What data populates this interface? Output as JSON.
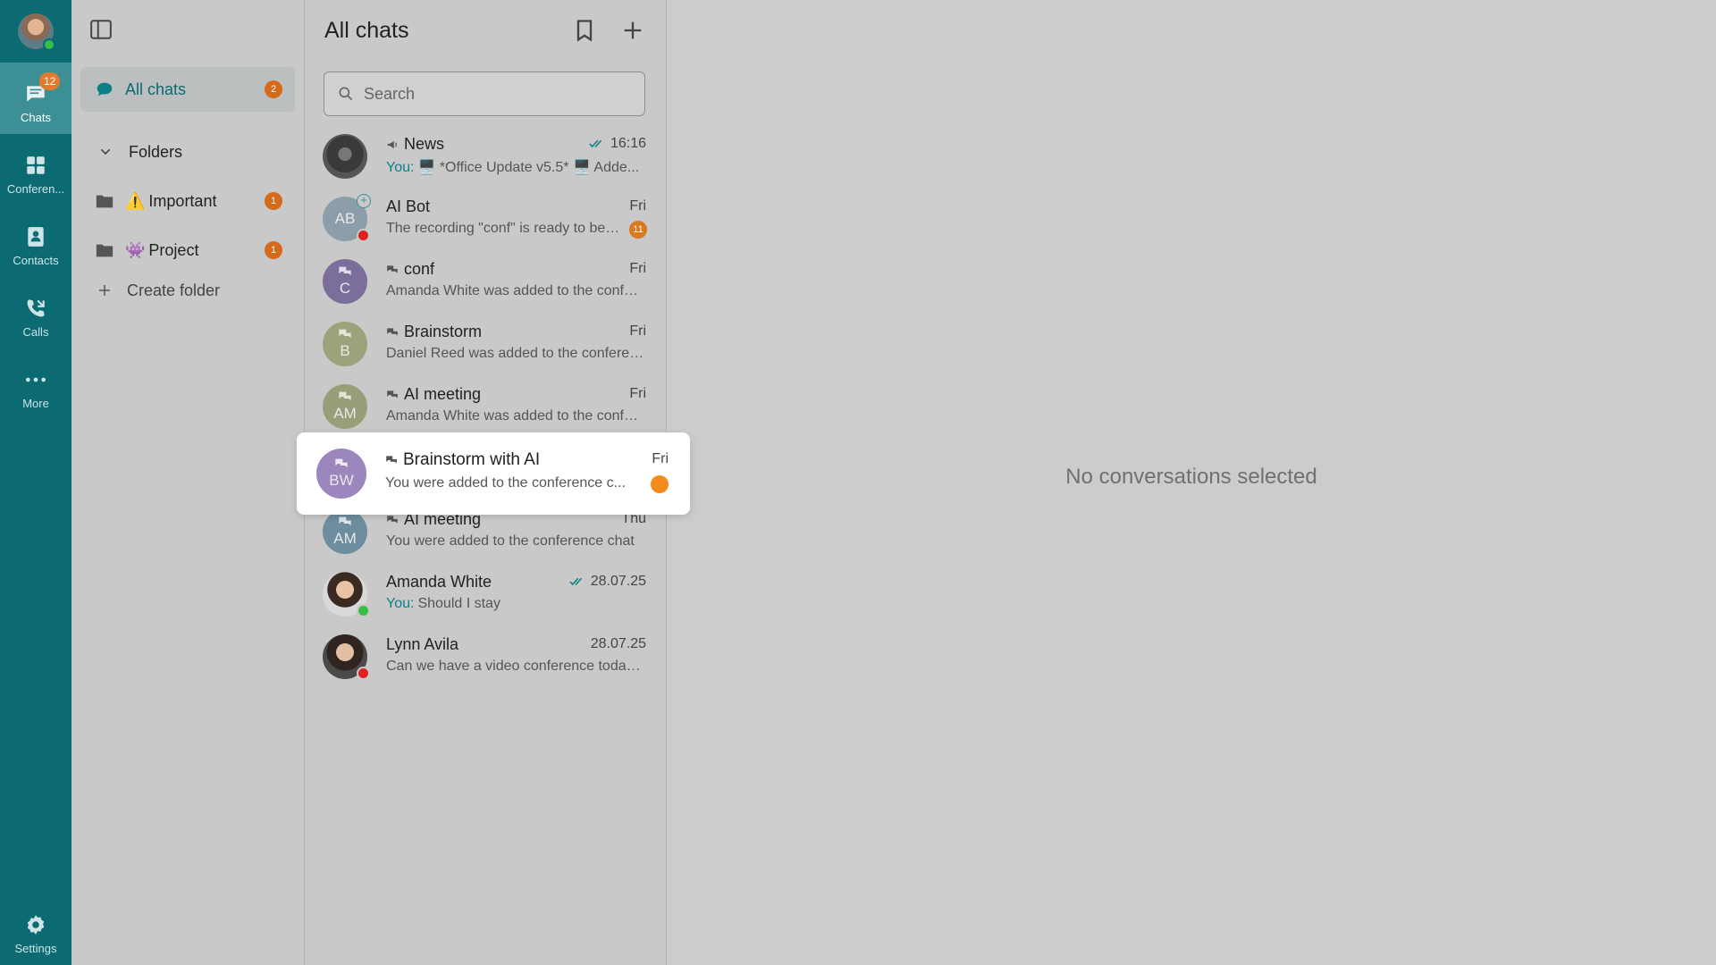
{
  "rail": {
    "items": [
      {
        "label": "Chats",
        "badge": "12",
        "icon": "chat-bubble-icon"
      },
      {
        "label": "Conferen...",
        "icon": "conference-grid-icon"
      },
      {
        "label": "Contacts",
        "icon": "contacts-icon"
      },
      {
        "label": "Calls",
        "icon": "phone-icon"
      },
      {
        "label": "More",
        "icon": "more-dots-icon"
      },
      {
        "label": "Settings",
        "icon": "gear-icon"
      }
    ]
  },
  "folders": {
    "all_chats": {
      "label": "All chats",
      "badge": "2"
    },
    "section_label": "Folders",
    "items": [
      {
        "emoji": "⚠️",
        "label": "Important",
        "badge": "1"
      },
      {
        "emoji": "👾",
        "label": "Project",
        "badge": "1"
      }
    ],
    "create_label": "Create folder"
  },
  "chatlist": {
    "title": "All chats",
    "search_placeholder": "Search",
    "rows": [
      {
        "name": "News",
        "time": "16:16",
        "you": "You:",
        "message": "🖥️ *Office Update v5.5* 🖥️ Adde..."
      },
      {
        "name": "AI Bot",
        "initials": "AB",
        "time": "Fri",
        "message": "The recording \"conf\" is ready to be t...",
        "unread": "11"
      },
      {
        "name": "conf",
        "initials": "C",
        "time": "Fri",
        "message": "Amanda White was added to the confer..."
      },
      {
        "name": "Brainstorm",
        "initials": "B",
        "time": "Fri",
        "message": "Daniel Reed was added to the conferen..."
      },
      {
        "name": "AI meeting",
        "initials": "AM",
        "time": "Fri",
        "message": "Amanda White was added to the confer..."
      },
      {
        "name": "Brainstorm with AI",
        "initials": "BW",
        "time": "Fri",
        "message": "You were added to the conference c..."
      },
      {
        "name": "AI meeting",
        "initials": "AM",
        "time": "Thu",
        "message": "You were added to the conference chat"
      },
      {
        "name": "Amanda White",
        "time": "28.07.25",
        "you": "You:",
        "message": "Should I stay"
      },
      {
        "name": "Lynn Avila",
        "time": "28.07.25",
        "message": "Can we have a video conference today ..."
      }
    ]
  },
  "main": {
    "empty_text": "No conversations selected"
  },
  "colors": {
    "rail": "#0b6a72",
    "accent": "#0b7f88",
    "badge": "#d46a1a"
  }
}
